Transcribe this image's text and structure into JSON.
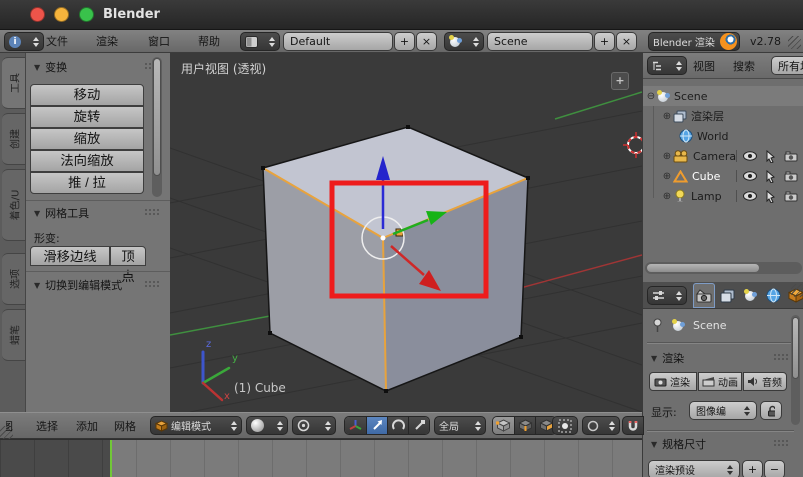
{
  "window": {
    "title": "Blender"
  },
  "symbols": {
    "plus": "+",
    "close": "×",
    "tri": "▼",
    "node_open": "⊕",
    "node_close": "⊖"
  },
  "infobar": {
    "menus": {
      "file": "文件",
      "render": "渲染",
      "window": "窗口",
      "help": "帮助"
    },
    "layout_value": "Default",
    "scene_value": "Scene",
    "engine_value": "Blender 渲染",
    "version": "v2.78"
  },
  "toolshelf": {
    "tabs": {
      "tools": "工具",
      "create": "创建",
      "shading": "着色/U",
      "options": "选项",
      "grease": "蜡笔"
    },
    "transform": {
      "title": "变换",
      "move": "移动",
      "rotate": "旋转",
      "scale": "缩放",
      "shrink_fatten": "法向缩放",
      "push_pull": "推 / 拉"
    },
    "meshtools": {
      "title": "网格工具",
      "deform_label": "形变:",
      "slide_edge": "滑移边线",
      "vertex": "顶点"
    },
    "toggle_panel_title": "切换到编辑模式"
  },
  "viewport": {
    "view_label": "用户视图 (透视)",
    "object_label": "(1) Cube",
    "add_button": "+",
    "axis": {
      "x": "x",
      "y": "y",
      "z": "z"
    }
  },
  "outliner": {
    "menus": {
      "view": "视图",
      "search": "搜索"
    },
    "scope_value": "所有场",
    "rows": [
      {
        "label": "Scene"
      },
      {
        "label": "渲染层"
      },
      {
        "label": "World"
      },
      {
        "label": "Camera"
      },
      {
        "label": "Cube"
      },
      {
        "label": "Lamp"
      }
    ]
  },
  "properties": {
    "context_name": "Scene",
    "render": {
      "title": "渲染",
      "render_btn": "渲染",
      "animation_btn": "动画",
      "audio_btn": "音频",
      "display_label": "显示:",
      "display_value": "图像编"
    },
    "dimensions": {
      "title": "规格尺寸",
      "preset_value": "渲染预设",
      "plus": "+",
      "minus": "−"
    }
  },
  "vheader": {
    "menus": {
      "view": "视图",
      "select": "选择",
      "add": "添加",
      "mesh": "网格"
    },
    "mode_value": "编辑模式",
    "orientation_value": "全局"
  },
  "colors": {
    "accent_blue": "#4772b3",
    "selection_orange": "#e8a33d",
    "annotation_red": "#ee1c1c",
    "frame_marker_green": "#71c837"
  }
}
